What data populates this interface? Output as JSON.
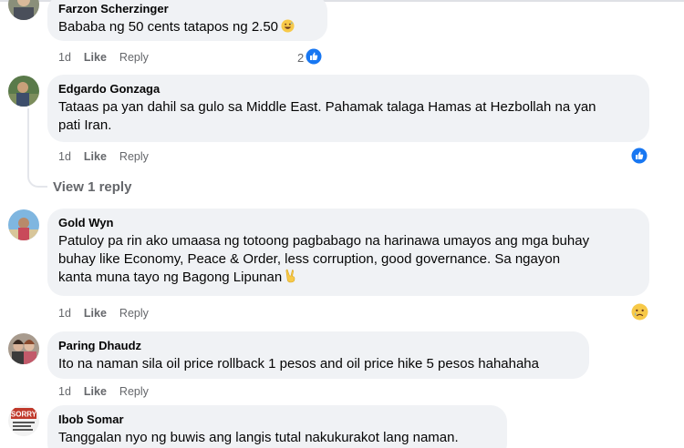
{
  "colors": {
    "bubble": "#f0f2f5",
    "meta": "#65676b",
    "like_blue": "#1877f2",
    "text": "#050505"
  },
  "comments": [
    {
      "author": "Farzon Scherzinger",
      "text": "Bababa ng 50 cents tatapos ng 2.50",
      "text_emoji": "grinning-sweat-emoji",
      "time": "1d",
      "like": "Like",
      "reply": "Reply",
      "reaction_count": "2",
      "reaction": "like-reaction-icon"
    },
    {
      "author": "Edgardo Gonzaga",
      "text_line1": "Tataas pa yan dahil sa gulo sa Middle East. Pahamak talaga Hamas at Hezbollah na yan",
      "text_line2": "pati Iran.",
      "time": "1d",
      "like": "Like",
      "reply": "Reply",
      "reaction": "like-reaction-icon"
    },
    {
      "author": "Gold Wyn",
      "text_line1": "Patuloy pa rin ako umaasa ng totoong pagbabago na harinawa umayos ang mga buhay",
      "text_line2": "buhay like Economy, Peace & Order, less corruption, good governance. Sa ngayon",
      "text_line3": "kanta muna tayo ng Bagong Lipunan",
      "text_emoji": "victory-hand-emoji",
      "time": "1d",
      "like": "Like",
      "reply": "Reply",
      "reaction": "sad-reaction-icon"
    },
    {
      "author": "Paring Dhaudz",
      "text": "Ito na naman sila oil price rollback 1 pesos and oil price hike 5 pesos hahahaha",
      "time": "1d",
      "like": "Like",
      "reply": "Reply"
    },
    {
      "author": "Ibob Somar",
      "text": "Tanggalan nyo ng buwis ang langis tutal nakukurakot lang naman.",
      "avatar_sign": "SORRY"
    }
  ],
  "view_replies": "View 1 reply"
}
